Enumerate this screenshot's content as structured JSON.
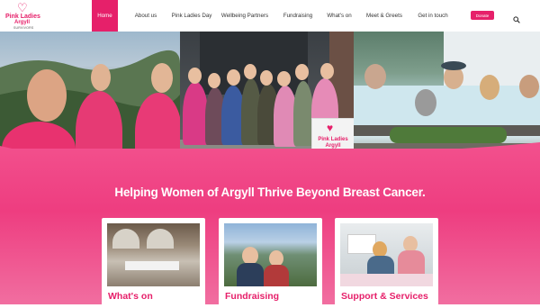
{
  "logo": {
    "line1": "Pink Ladies",
    "line2": "Argyll",
    "line3": "SURVIVORS"
  },
  "nav": {
    "items": [
      {
        "label": "Home",
        "active": true
      },
      {
        "label": "About us"
      },
      {
        "label": "Pink Ladies Day"
      },
      {
        "label": "Wellbeing Partners"
      },
      {
        "label": "Fundraising"
      },
      {
        "label": "What's on"
      },
      {
        "label": "Meet & Greets"
      },
      {
        "label": "Get in touch"
      }
    ],
    "donate_label": "Donate",
    "search_icon": "search-icon"
  },
  "colors": {
    "brand_pink": "#e6206a",
    "section_pink": "#ee3d80"
  },
  "tagline": "Helping Women of Argyll Thrive Beyond Breast Cancer.",
  "hero": {
    "sign_text": "Pink Ladies Argyll"
  },
  "cards": [
    {
      "title": "What's on"
    },
    {
      "title": "Fundraising"
    },
    {
      "title": "Support & Services"
    }
  ]
}
